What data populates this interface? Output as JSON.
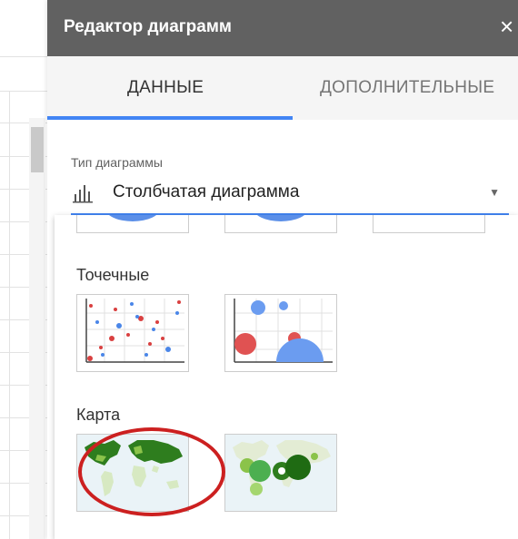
{
  "editor": {
    "title": "Редактор диаграмм",
    "close_glyph": "×",
    "tabs": [
      {
        "label": "ДАННЫЕ",
        "active": true
      },
      {
        "label": "ДОПОЛНИТЕЛЬНЫЕ",
        "active": false
      }
    ],
    "chart_type_field": {
      "label": "Тип диаграммы",
      "value": "Столбчатая диаграмма",
      "icon": "bar-chart-icon",
      "caret": "▼"
    }
  },
  "dropdown": {
    "sections": [
      {
        "title": "Точечные",
        "options": [
          "scatter-chart-icon",
          "bubble-chart-icon"
        ]
      },
      {
        "title": "Карта",
        "options": [
          "geo-chart-icon",
          "geo-bubble-chart-icon"
        ]
      }
    ],
    "highlighted_option": "geo-chart-icon"
  },
  "colors": {
    "header": "#616161",
    "accent": "#4285f4",
    "highlight_circle": "#cc2020",
    "map_green": "#2e7d1e"
  }
}
